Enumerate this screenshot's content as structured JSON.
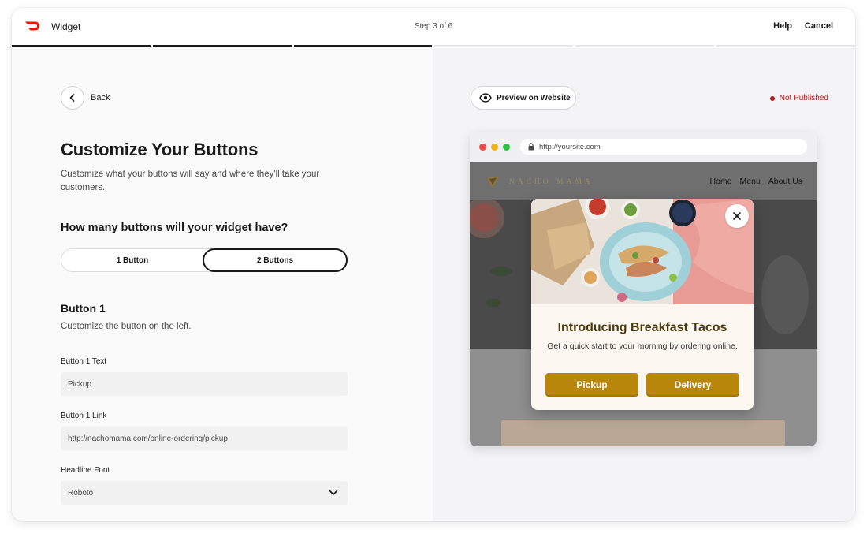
{
  "header": {
    "app_title": "Widget",
    "step": "Step 3 of 6",
    "help": "Help",
    "cancel": "Cancel",
    "progress": {
      "total_steps": 6,
      "completed_steps": 3
    }
  },
  "left": {
    "back": "Back",
    "title": "Customize Your Buttons",
    "subtitle": "Customize what your buttons will say and where they'll take your customers.",
    "question": "How many buttons will your widget have?",
    "button_count_options": [
      {
        "label": "1 Button",
        "selected": false
      },
      {
        "label": "2 Buttons",
        "selected": true
      }
    ],
    "button1": {
      "heading": "Button 1",
      "description": "Customize the button on the left.",
      "text_label": "Button 1 Text",
      "text_value": "Pickup",
      "link_label": "Button 1 Link",
      "link_value": "http://nachomama.com/online-ordering/pickup",
      "font_label": "Headline Font",
      "font_value": "Roboto"
    }
  },
  "right": {
    "preview_button": "Preview on Website",
    "status": "Not Published",
    "status_color": "#b11c1c",
    "browser": {
      "url": "http://yoursite.com",
      "site_brand": "NACHO MAMA",
      "nav": [
        "Home",
        "Menu",
        "About Us"
      ]
    },
    "widget": {
      "headline": "Introducing Breakfast Tacos",
      "body": "Get a quick start to your morning by ordering online.",
      "button_1": "Pickup",
      "button_2": "Delivery",
      "button_color": "#b8860b"
    }
  },
  "colors": {
    "brand_red": "#eb1700",
    "text_dark": "#191919"
  }
}
